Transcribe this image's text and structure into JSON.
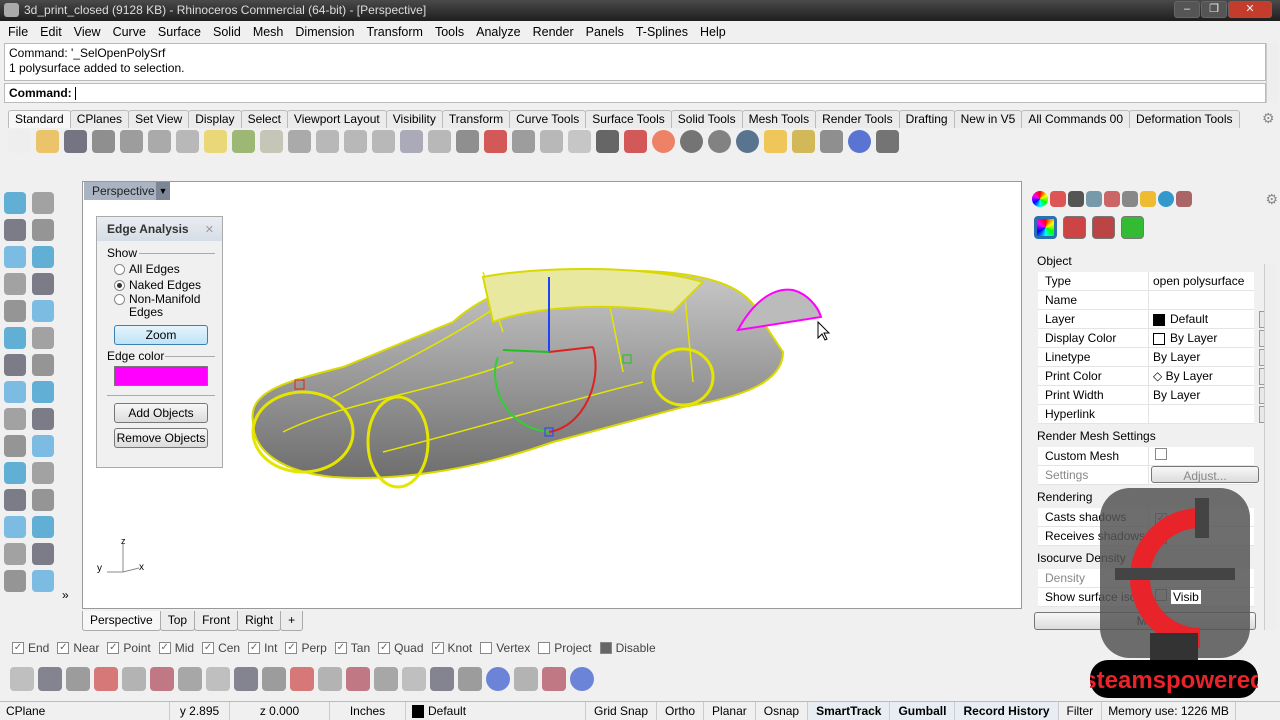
{
  "window": {
    "title": "3d_print_closed (9128 KB) - Rhinoceros Commercial (64-bit) - [Perspective]"
  },
  "menu": [
    "File",
    "Edit",
    "View",
    "Curve",
    "Surface",
    "Solid",
    "Mesh",
    "Dimension",
    "Transform",
    "Tools",
    "Analyze",
    "Render",
    "Panels",
    "T-Splines",
    "Help"
  ],
  "command": {
    "history": [
      "Command: '_SelOpenPolySrf",
      "1 polysurface added to selection."
    ],
    "prompt": "Command:",
    "value": ""
  },
  "toolbar_tabs": [
    "Standard",
    "CPlanes",
    "Set View",
    "Display",
    "Select",
    "Viewport Layout",
    "Visibility",
    "Transform",
    "Curve Tools",
    "Surface Tools",
    "Solid Tools",
    "Mesh Tools",
    "Render Tools",
    "Drafting",
    "New in V5",
    "All Commands 00",
    "Deformation Tools"
  ],
  "standard_tools": [
    "new-file",
    "open",
    "save",
    "print",
    "import",
    "cut",
    "copy",
    "paste",
    "undo",
    "pan",
    "rotate-view",
    "zoom-dynamic",
    "zoom-window",
    "zoom-extents",
    "zoom-selected",
    "zoom-all",
    "four-viewports",
    "car-options",
    "grid-options",
    "polar-options",
    "hide",
    "lock",
    "layer",
    "color-wheel",
    "wireframe-shade",
    "ghosted",
    "rendered",
    "light",
    "gear-options",
    "dimension",
    "help",
    "camera"
  ],
  "viewport": {
    "label": "Perspective",
    "axes": {
      "x": "x",
      "y": "y",
      "z": "z"
    },
    "tabs": [
      "Perspective",
      "Top",
      "Front",
      "Right"
    ],
    "add_tab": "+"
  },
  "edge_analysis": {
    "title": "Edge Analysis",
    "show_label": "Show",
    "options": [
      {
        "label": "All Edges",
        "selected": false
      },
      {
        "label": "Naked Edges",
        "selected": true
      },
      {
        "label": "Non-Manifold",
        "label2": "Edges",
        "selected": false
      }
    ],
    "zoom": "Zoom",
    "edge_color_label": "Edge color",
    "edge_color": "#ff00ff",
    "add": "Add Objects",
    "remove": "Remove Objects"
  },
  "properties": {
    "object_header": "Object",
    "rows": [
      {
        "k": "Type",
        "v": "open polysurface"
      },
      {
        "k": "Name",
        "v": ""
      },
      {
        "k": "Layer",
        "v": "Default",
        "swatch": "#000000",
        "dd": true
      },
      {
        "k": "Display Color",
        "v": "By Layer",
        "swatch": "#ffffff",
        "dd": true
      },
      {
        "k": "Linetype",
        "v": "By Layer",
        "dd": true
      },
      {
        "k": "Print Color",
        "v": "◇ By Layer",
        "dd": true
      },
      {
        "k": "Print Width",
        "v": "By Layer",
        "dd": true
      },
      {
        "k": "Hyperlink",
        "v": "",
        "more": "..."
      }
    ],
    "render_mesh_header": "Render Mesh Settings",
    "custom_mesh": "Custom Mesh",
    "settings": "Settings",
    "adjust": "Adjust...",
    "rendering_header": "Rendering",
    "casts": "Casts shadows",
    "receives": "Receives shadows",
    "iso_header": "Isocurve Density",
    "density": "Density",
    "show_iso": "Show surface isoc...",
    "visible": "Visib",
    "match": "Ma"
  },
  "osnaps": [
    {
      "label": "End",
      "on": true
    },
    {
      "label": "Near",
      "on": true
    },
    {
      "label": "Point",
      "on": true
    },
    {
      "label": "Mid",
      "on": true
    },
    {
      "label": "Cen",
      "on": true
    },
    {
      "label": "Int",
      "on": true
    },
    {
      "label": "Perp",
      "on": true
    },
    {
      "label": "Tan",
      "on": true
    },
    {
      "label": "Quad",
      "on": true
    },
    {
      "label": "Knot",
      "on": true
    },
    {
      "label": "Vertex",
      "on": false
    },
    {
      "label": "Project",
      "on": false
    },
    {
      "label": "Disable",
      "on": false
    }
  ],
  "status": {
    "cplane": "CPlane",
    "y": "y 2.895",
    "z": "z 0.000",
    "units": "Inches",
    "layer": "Default",
    "buttons": [
      "Grid Snap",
      "Ortho",
      "Planar",
      "Osnap",
      "SmartTrack",
      "Gumball",
      "Record History",
      "Filter"
    ],
    "bold": [
      "SmartTrack",
      "Gumball",
      "Record History"
    ],
    "memory": "Memory use: 1226 MB"
  },
  "watermark": "steamspowered"
}
